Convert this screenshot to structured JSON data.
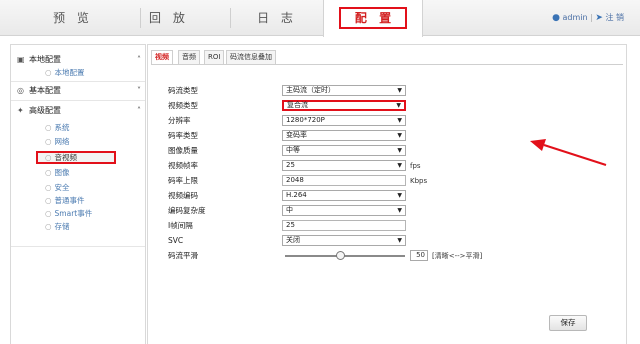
{
  "nav": {
    "tabs": [
      "预 览",
      "回 放",
      "日 志",
      "配 置"
    ],
    "active": "配 置",
    "user": "admin",
    "logout": "注 销"
  },
  "sidebar": {
    "local": {
      "title": "本地配置",
      "items": [
        "本地配置"
      ]
    },
    "basic": {
      "title": "基本配置"
    },
    "advanced": {
      "title": "高级配置",
      "items": [
        "系统",
        "网络",
        "音视频",
        "图像",
        "安全",
        "普通事件",
        "Smart事件",
        "存储"
      ]
    },
    "selected": "音视频"
  },
  "tabs": [
    "视频",
    "音频",
    "ROI",
    "码流信息叠加"
  ],
  "form": {
    "stream_type": {
      "label": "码流类型",
      "value": "主码流（定时）"
    },
    "video_type": {
      "label": "视频类型",
      "value": "复合流"
    },
    "resolution": {
      "label": "分辨率",
      "value": "1280*720P"
    },
    "bitrate_type": {
      "label": "码率类型",
      "value": "变码率"
    },
    "image_quality": {
      "label": "图像质量",
      "value": "中等"
    },
    "frame_rate": {
      "label": "视频帧率",
      "value": "25",
      "unit": "fps"
    },
    "bitrate_max": {
      "label": "码率上限",
      "value": "2048",
      "unit": "Kbps"
    },
    "encoding": {
      "label": "视频编码",
      "value": "H.264"
    },
    "complexity": {
      "label": "编码复杂度",
      "value": "中"
    },
    "iframe_interval": {
      "label": "I帧间隔",
      "value": "25"
    },
    "svc": {
      "label": "SVC",
      "value": "关闭"
    },
    "smoothing": {
      "label": "码流平滑",
      "value": "50",
      "hint": "[清晰<-->平滑]",
      "level": 0.5
    }
  },
  "save_label": "保存",
  "colors": {
    "accent_red": "#e2101a",
    "link_blue": "#4a7ab0"
  }
}
